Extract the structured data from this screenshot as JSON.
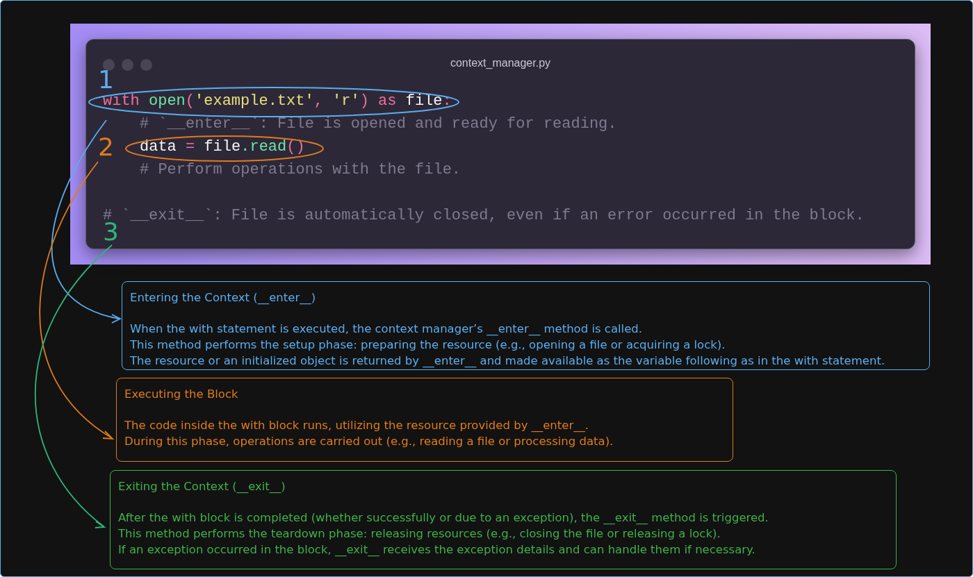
{
  "window": {
    "title": "context_manager.py"
  },
  "code": {
    "lines": [
      {
        "kind": "code",
        "indented": false,
        "tokens": [
          {
            "text": "with ",
            "kind": "keyword"
          },
          {
            "text": "open",
            "kind": "function"
          },
          {
            "text": "(",
            "kind": "punct"
          },
          {
            "text": "'example.txt'",
            "kind": "string"
          },
          {
            "text": ", ",
            "kind": "punct"
          },
          {
            "text": "'r'",
            "kind": "string"
          },
          {
            "text": ") ",
            "kind": "punct"
          },
          {
            "text": "as ",
            "kind": "keyword"
          },
          {
            "text": "file",
            "kind": "name"
          },
          {
            "text": ":",
            "kind": "punct"
          }
        ]
      },
      {
        "kind": "code",
        "indented": true,
        "tokens": [
          {
            "text": "# `__enter__`: File is opened and ready for reading.",
            "kind": "comment"
          }
        ]
      },
      {
        "kind": "code",
        "indented": true,
        "tokens": [
          {
            "text": "data",
            "kind": "name"
          },
          {
            "text": " = ",
            "kind": "punct"
          },
          {
            "text": "file",
            "kind": "name"
          },
          {
            "text": ".read",
            "kind": "function"
          },
          {
            "text": "()",
            "kind": "punct"
          }
        ]
      },
      {
        "kind": "code",
        "indented": true,
        "tokens": [
          {
            "text": "# Perform operations with the file.",
            "kind": "comment"
          }
        ]
      },
      {
        "kind": "blank"
      },
      {
        "kind": "code",
        "indented": false,
        "tokens": [
          {
            "text": "# `__exit__`: File is automatically closed, even if an error occurred in the block.",
            "kind": "comment"
          }
        ]
      }
    ]
  },
  "markers": [
    {
      "label": "1",
      "color": "#5aaef0"
    },
    {
      "label": "2",
      "color": "#e07b1a"
    },
    {
      "label": "3",
      "color": "#2fb57a"
    }
  ],
  "cards": [
    {
      "title": "Entering the Context (__enter__)",
      "color": "#5aaef0",
      "lines": [
        "When the with statement is executed, the context manager’s __enter__ method is called.",
        "This method performs the setup phase: preparing the resource (e.g., opening a file or acquiring a lock).",
        "The resource or an initialized object is returned by __enter__ and made available as the variable following as in the with statement."
      ]
    },
    {
      "title": "Executing the Block",
      "color": "#e07b1a",
      "lines": [
        "The code inside the with block runs, utilizing the resource provided by __enter__.",
        "During this phase, operations are carried out (e.g., reading a file or processing data)."
      ]
    },
    {
      "title": "Exiting the Context (__exit__)",
      "color": "#3fb04a",
      "lines": [
        "After the with block is completed (whether successfully or due to an exception), the __exit__ method is triggered.",
        "This method performs the teardown phase: releasing resources (e.g., closing the file or releasing a lock).",
        "If an exception occurred in the block, __exit__ receives the exception details and can handle them if necessary."
      ]
    }
  ]
}
